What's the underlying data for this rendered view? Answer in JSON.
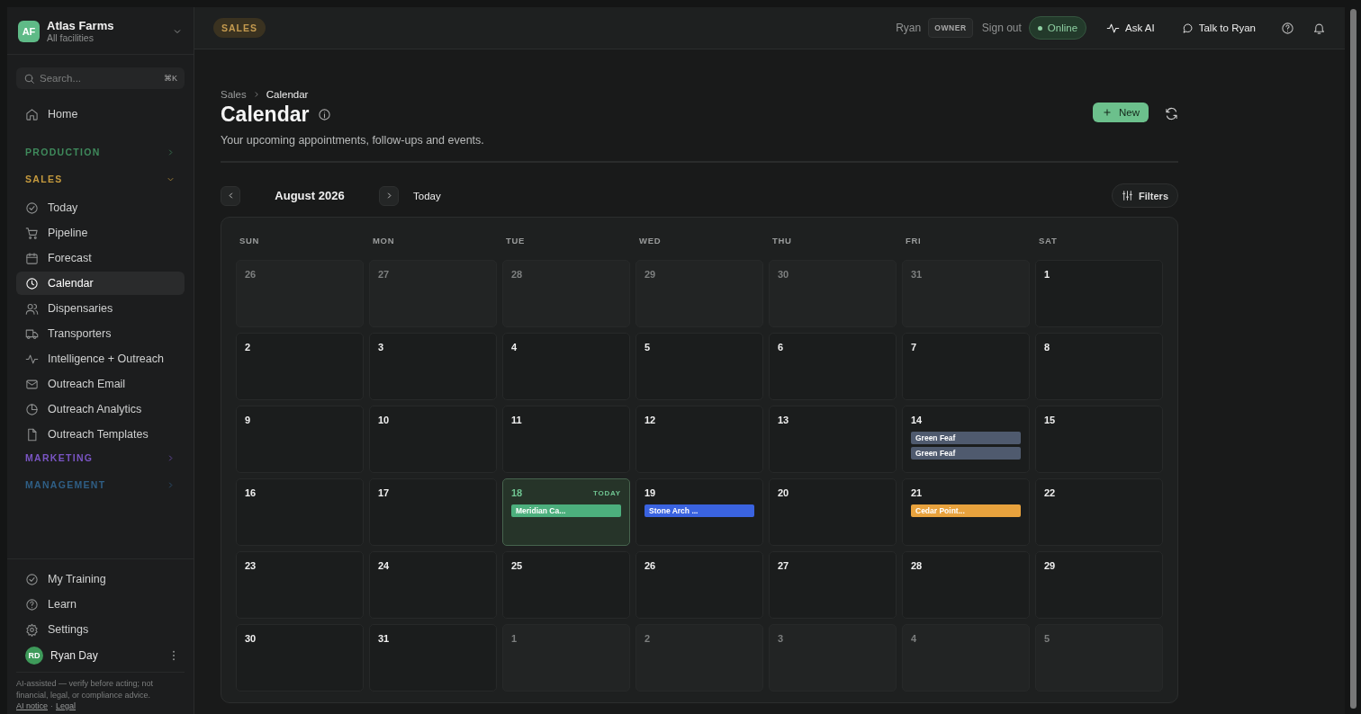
{
  "org": {
    "initials": "AF",
    "name": "Atlas Farms",
    "subtitle": "All facilities"
  },
  "search": {
    "placeholder": "Search...",
    "shortcut": "⌘K"
  },
  "nav": [
    {
      "kind": "item",
      "label": "Home",
      "selected": false
    },
    {
      "kind": "section",
      "label": "PRODUCTION",
      "color": "#3f8a5c",
      "expanded": false
    },
    {
      "kind": "section",
      "label": "SALES",
      "color": "#c59a3e",
      "expanded": true,
      "children": [
        {
          "label": "Today",
          "selected": false
        },
        {
          "label": "Pipeline",
          "selected": false
        },
        {
          "label": "Forecast",
          "selected": false
        },
        {
          "label": "Calendar",
          "selected": true
        },
        {
          "label": "Dispensaries",
          "selected": false
        },
        {
          "label": "Transporters",
          "selected": false
        },
        {
          "label": "Intelligence + Outreach",
          "selected": false
        },
        {
          "label": "Outreach Email",
          "selected": false
        },
        {
          "label": "Outreach Analytics",
          "selected": false
        },
        {
          "label": "Outreach Templates",
          "selected": false
        }
      ]
    },
    {
      "kind": "section",
      "label": "MARKETING",
      "color": "#7a55c4",
      "expanded": false
    },
    {
      "kind": "section",
      "label": "MANAGEMENT",
      "color": "#2f5f86",
      "expanded": false
    }
  ],
  "footer_nav": [
    {
      "label": "My Training"
    },
    {
      "label": "Learn"
    },
    {
      "label": "Settings"
    }
  ],
  "user": {
    "initials": "RD",
    "name": "Ryan Day"
  },
  "disclaimer": "AI-assisted — verify before acting; not financial, legal, or compliance advice.",
  "footer_links": [
    "AI notice",
    "Legal"
  ],
  "footer_separator": "·",
  "topbar": {
    "section_badge": "SALES",
    "user": "Ryan",
    "role": "OWNER",
    "sign_out": "Sign out",
    "status": "Online",
    "online": true,
    "ask_ai": "Ask AI",
    "talk": "Talk to Ryan"
  },
  "breadcrumb": [
    "Sales",
    "Calendar"
  ],
  "title": "Calendar",
  "subtitle": "Your upcoming appointments, follow-ups and events.",
  "new_button": "New",
  "month": "August 2026",
  "today_button": "Today",
  "filters_button": "Filters",
  "weekdays": [
    "SUN",
    "MON",
    "TUE",
    "WED",
    "THU",
    "FRI",
    "SAT"
  ],
  "days": [
    {
      "day": "26",
      "muted": true
    },
    {
      "day": "27",
      "muted": true
    },
    {
      "day": "28",
      "muted": true
    },
    {
      "day": "29",
      "muted": true
    },
    {
      "day": "30",
      "muted": true
    },
    {
      "day": "31",
      "muted": true
    },
    {
      "day": "1",
      "muted": false
    },
    {
      "day": "2",
      "muted": false
    },
    {
      "day": "3",
      "muted": false
    },
    {
      "day": "4",
      "muted": false
    },
    {
      "day": "5",
      "muted": false
    },
    {
      "day": "6",
      "muted": false
    },
    {
      "day": "7",
      "muted": false
    },
    {
      "day": "8",
      "muted": false
    },
    {
      "day": "9",
      "muted": false
    },
    {
      "day": "10",
      "muted": false
    },
    {
      "day": "11",
      "muted": false
    },
    {
      "day": "12",
      "muted": false
    },
    {
      "day": "13",
      "muted": false
    },
    {
      "day": "14",
      "muted": false,
      "events": [
        {
          "title": "Green Feaf",
          "color": "#4f5a6e"
        },
        {
          "title": "Green Feaf",
          "color": "#4f5a6e"
        }
      ]
    },
    {
      "day": "15",
      "muted": false
    },
    {
      "day": "16",
      "muted": false
    },
    {
      "day": "17",
      "muted": false
    },
    {
      "day": "18",
      "muted": false,
      "today": true,
      "today_label": "TODAY",
      "events": [
        {
          "title": "Meridian Ca...",
          "color": "#4caf7d"
        }
      ]
    },
    {
      "day": "19",
      "muted": false,
      "events": [
        {
          "title": "Stone Arch ...",
          "color": "#3a63e0"
        }
      ]
    },
    {
      "day": "20",
      "muted": false
    },
    {
      "day": "21",
      "muted": false,
      "events": [
        {
          "title": "Cedar Point...",
          "color": "#e8a23d"
        }
      ]
    },
    {
      "day": "22",
      "muted": false
    },
    {
      "day": "23",
      "muted": false
    },
    {
      "day": "24",
      "muted": false
    },
    {
      "day": "25",
      "muted": false
    },
    {
      "day": "26",
      "muted": false
    },
    {
      "day": "27",
      "muted": false
    },
    {
      "day": "28",
      "muted": false
    },
    {
      "day": "29",
      "muted": false
    },
    {
      "day": "30",
      "muted": false
    },
    {
      "day": "31",
      "muted": false
    },
    {
      "day": "1",
      "muted": true
    },
    {
      "day": "2",
      "muted": true
    },
    {
      "day": "3",
      "muted": true
    },
    {
      "day": "4",
      "muted": true
    },
    {
      "day": "5",
      "muted": true
    }
  ]
}
